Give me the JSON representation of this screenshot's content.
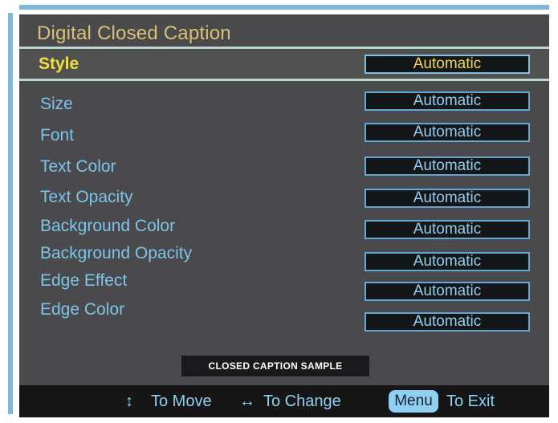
{
  "title": "Digital Closed Caption",
  "rows": [
    {
      "label": "Style",
      "value": "Automatic"
    },
    {
      "label": "Size",
      "value": "Automatic"
    },
    {
      "label": "Font",
      "value": "Automatic"
    },
    {
      "label": "Text Color",
      "value": "Automatic"
    },
    {
      "label": "Text Opacity",
      "value": "Automatic"
    },
    {
      "label": "Background Color",
      "value": "Automatic"
    },
    {
      "label": "Background Opacity",
      "value": "Automatic"
    },
    {
      "label": "Edge Effect",
      "value": "Automatic"
    },
    {
      "label": "Edge Color",
      "value": "Automatic"
    }
  ],
  "sample": "CLOSED CAPTION SAMPLE",
  "footer": {
    "move_icon": "↕",
    "move_label": "To Move",
    "change_icon": "↔",
    "change_label": "To Change",
    "menu_key": "Menu",
    "exit_label": "To Exit"
  },
  "colors": {
    "panel": "#4a4a4c",
    "title": "#d6c07a",
    "selected_label": "#f3de41",
    "label": "#7cc4ea",
    "value_box": "#151618",
    "value_border": "#61a8d6",
    "accent_rule": "#7fb7d8"
  }
}
